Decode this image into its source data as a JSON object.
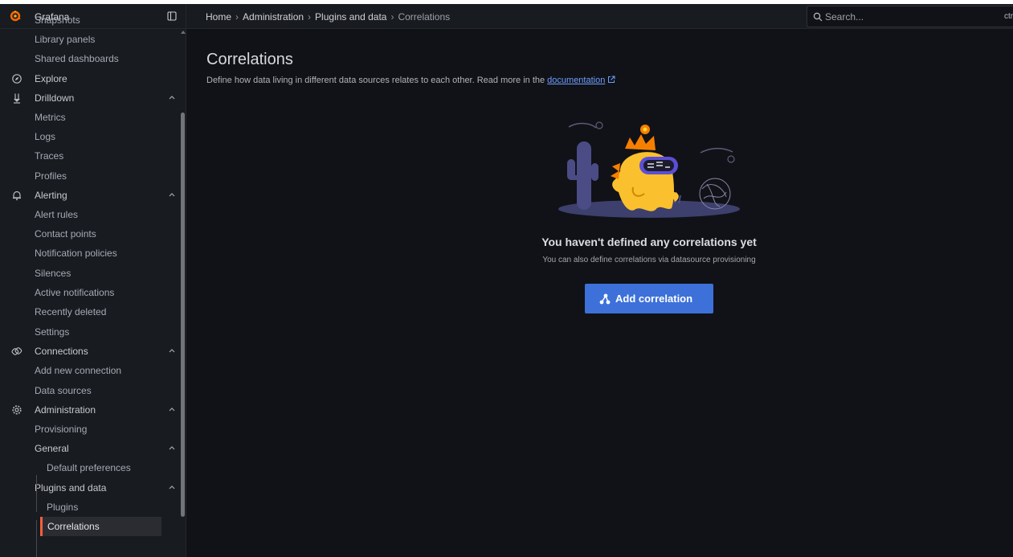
{
  "app": {
    "name": "Grafana",
    "accent": "#f55f3e",
    "primary": "#3d71d9"
  },
  "sidebar": {
    "items": [
      {
        "label": "Snapshots"
      },
      {
        "label": "Library panels"
      },
      {
        "label": "Shared dashboards"
      },
      {
        "label": "Explore",
        "icon": "compass-icon"
      },
      {
        "label": "Drilldown",
        "icon": "drilldown-icon",
        "expanded": true
      },
      {
        "label": "Metrics"
      },
      {
        "label": "Logs"
      },
      {
        "label": "Traces"
      },
      {
        "label": "Profiles"
      },
      {
        "label": "Alerting",
        "icon": "bell-icon",
        "expanded": true
      },
      {
        "label": "Alert rules"
      },
      {
        "label": "Contact points"
      },
      {
        "label": "Notification policies"
      },
      {
        "label": "Silences"
      },
      {
        "label": "Active notifications"
      },
      {
        "label": "Recently deleted"
      },
      {
        "label": "Settings"
      },
      {
        "label": "Connections",
        "icon": "connections-icon",
        "expanded": true
      },
      {
        "label": "Add new connection"
      },
      {
        "label": "Data sources"
      },
      {
        "label": "Administration",
        "icon": "cog-icon",
        "expanded": true
      },
      {
        "label": "Provisioning"
      },
      {
        "label": "General",
        "expanded": true
      },
      {
        "label": "Default preferences"
      },
      {
        "label": "Plugins and data",
        "expanded": true
      },
      {
        "label": "Plugins"
      },
      {
        "label": "Correlations",
        "active": true
      }
    ]
  },
  "breadcrumb": [
    "Home",
    "Administration",
    "Plugins and data",
    "Correlations"
  ],
  "search": {
    "placeholder": "Search...",
    "shortcut": "ctrl+"
  },
  "page": {
    "title": "Correlations",
    "description": "Define how data living in different data sources relates to each other. Read more in the",
    "doc_link": "documentation"
  },
  "empty_state": {
    "title": "You haven't defined any correlations yet",
    "subtitle": "You can also define correlations via datasource provisioning",
    "button": "Add correlation"
  }
}
